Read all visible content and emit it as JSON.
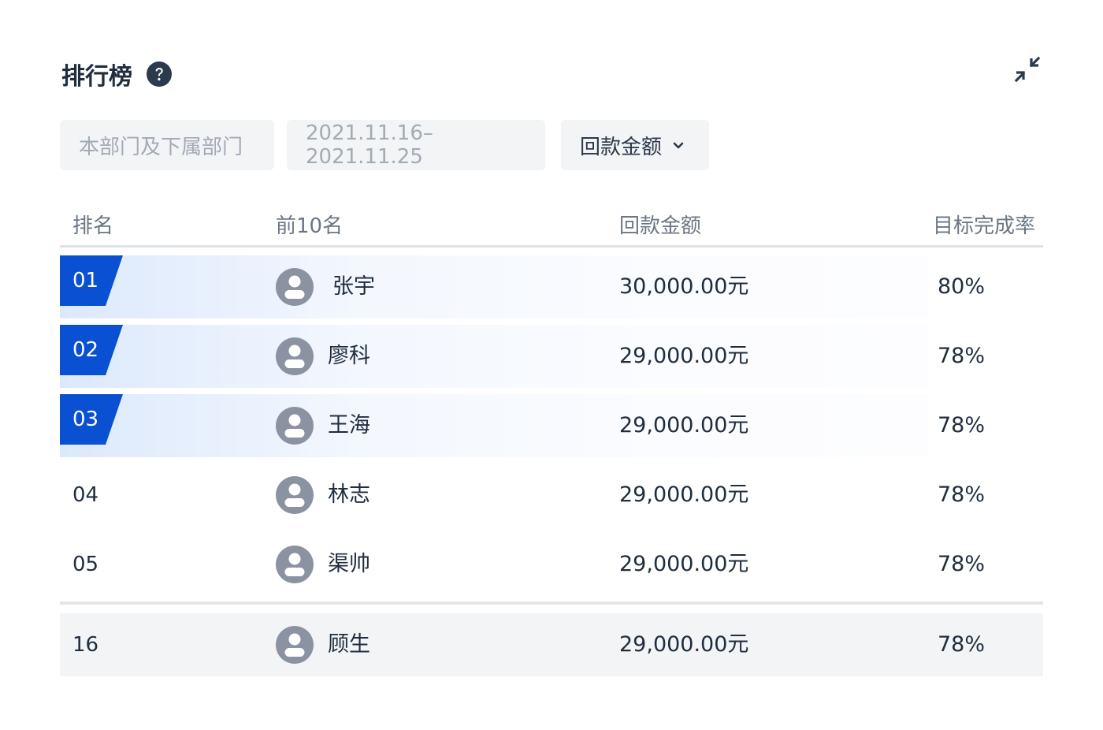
{
  "header": {
    "title": "排行榜",
    "help_icon": "question-circle-icon",
    "collapse_icon": "collapse-arrows-icon"
  },
  "filters": {
    "department": "本部门及下属部门",
    "date_range": "2021.11.16–2021.11.25",
    "metric": "回款金额"
  },
  "table": {
    "columns": {
      "rank": "排名",
      "name": "前10名",
      "amount": "回款金额",
      "rate": "目标完成率"
    },
    "rows": [
      {
        "rank": "01",
        "name": "张宇",
        "amount": "30,000.00元",
        "rate": "80%",
        "highlight": true
      },
      {
        "rank": "02",
        "name": "廖科",
        "amount": "29,000.00元",
        "rate": "78%",
        "highlight": true
      },
      {
        "rank": "03",
        "name": "王海",
        "amount": "29,000.00元",
        "rate": "78%",
        "highlight": true
      },
      {
        "rank": "04",
        "name": "林志",
        "amount": "29,000.00元",
        "rate": "78%",
        "highlight": false
      },
      {
        "rank": "05",
        "name": "渠帅",
        "amount": "29,000.00元",
        "rate": "78%",
        "highlight": false
      }
    ],
    "self_row": {
      "rank": "16",
      "name": "顾生",
      "amount": "29,000.00元",
      "rate": "78%"
    }
  },
  "colors": {
    "badge_blue": "#0a50d2",
    "text": "#1f2d3d",
    "muted": "#a3aab5",
    "avatar": "#8b93a2"
  }
}
